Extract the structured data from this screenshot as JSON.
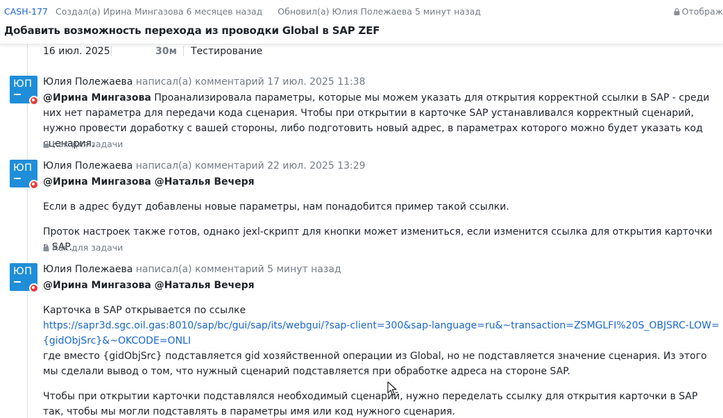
{
  "header": {
    "issue_key": "CASH-177",
    "created": "Создал(а) Ирина Мингазова 6 месяцев назад",
    "updated": "Обновил(а) Юлия Полежаева 5 минут назад",
    "visibility": "Отображ",
    "title": "Добавить возможность перехода из проводки Global в SAP ZEF"
  },
  "worklog": {
    "date": "16 июл. 2025",
    "duration": "30м",
    "type": "Тестирование"
  },
  "comments": [
    {
      "avatar": "ЮП",
      "author": "Юлия Полежаева",
      "action": "написал(а) комментарий 17 июл. 2025 11:38",
      "mention": "@Ирина Мингазова",
      "text": " Проанализировала параметры, которые мы можем указать для открытия корректной ссылки в SAP - среди них нет параметра для передачи кода сценария. Чтобы при открытии в карточке SAP устанавливался корректный сценарий, нужно провести доработку с вашей стороны, либо подготовить новый адрес, в параметрах которого можно будет указать код сценария.",
      "visibility": "Как для задачи"
    },
    {
      "avatar": "ЮП",
      "author": "Юлия Полежаева",
      "action": "написал(а) комментарий 22 июл. 2025 13:29",
      "mentions": "@Ирина Мингазова @Наталья Вечеря",
      "p1": "Если в адрес будут добавлены новые параметры, нам понадобится пример такой ссылки.",
      "p2": "Проток настроек также готов, однако jexl-скрипт для кнопки может измениться, если изменится ссылка для открытия карточки в SAP.",
      "visibility": "Как для задачи"
    },
    {
      "avatar": "ЮП",
      "author": "Юлия Полежаева",
      "action": "написал(а) комментарий 5 минут назад",
      "mentions": "@Ирина Мингазова @Наталья Вечеря",
      "p1": "Карточка в SAP открывается по ссылке",
      "link": "https://sapr3d.sgc.oil.gas:8010/sap/bc/gui/sap/its/webgui/?sap-client=300&sap-language=ru&~transaction=ZSMGLFI%20S_OBJSRC-LOW={gidObjSrc}&~OKCODE=ONLI",
      "p2": "где вместо {gidObjSrc} подставляется gid хозяйственной операции из Global, но не подставляется значение сценария. Из этого мы сделали вывод о том, что нужный сценарий подставляется при обработке адреса на стороне SAP.",
      "p3": "Чтобы при открытии карточки подставлялся необходимый сценарий, нужно переделать ссылку для открытия карточки в SAP так, чтобы мы могли подставлять в параметры имя или код нужного сценария."
    }
  ],
  "colors": {
    "accent": "#1a66cc",
    "avatar_bg": "#1f8ed8",
    "badge": "#e43c3c",
    "muted": "#747b85"
  }
}
